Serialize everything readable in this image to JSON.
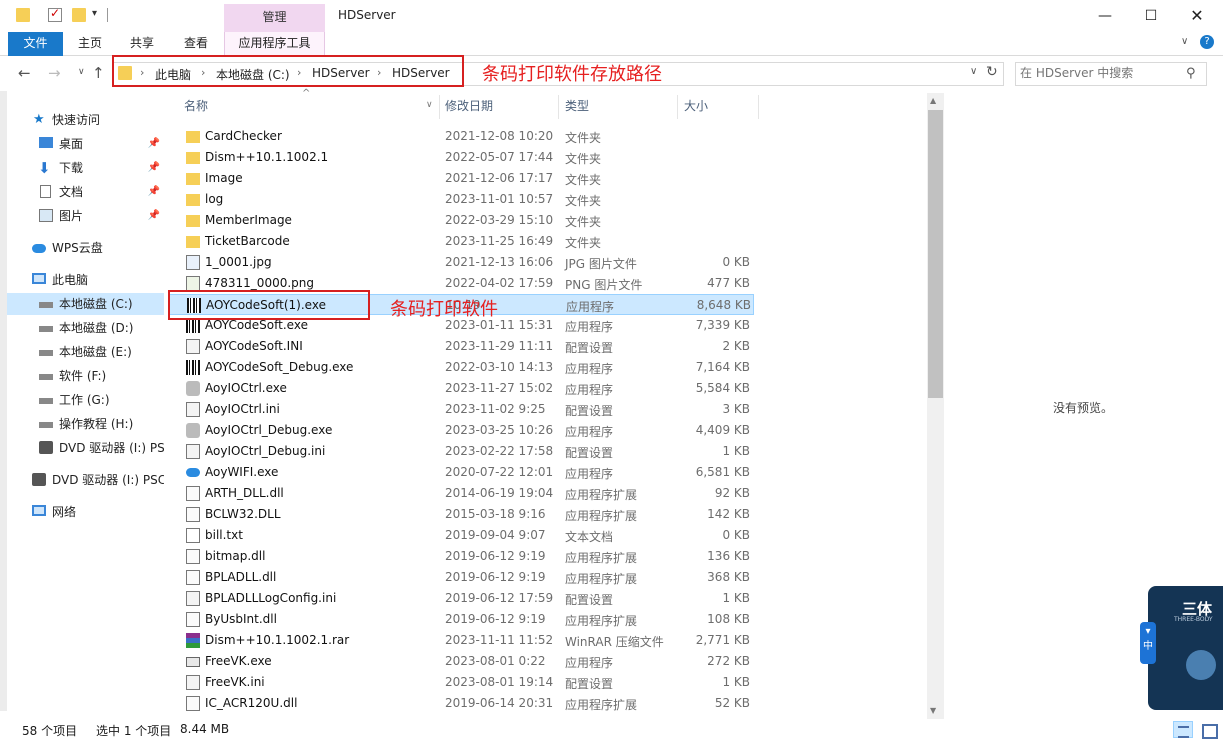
{
  "window": {
    "title": "HDServer",
    "manage_label": "管理"
  },
  "ribbon": {
    "file": "文件",
    "home": "主页",
    "share": "共享",
    "view": "查看",
    "app_tools": "应用程序工具"
  },
  "address": {
    "crumbs": [
      "此电脑",
      "本地磁盘 (C:)",
      "HDServer",
      "HDServer"
    ],
    "search_placeholder": "在 HDServer 中搜索"
  },
  "annotations": {
    "address": "条码打印软件存放路径",
    "row": "条码打印软件"
  },
  "nav": {
    "quick_access": "快速访问",
    "desktop": "桌面",
    "downloads": "下载",
    "documents": "文档",
    "pictures": "图片",
    "wps": "WPS云盘",
    "this_pc": "此电脑",
    "drive_c": "本地磁盘 (C:)",
    "drive_d": "本地磁盘 (D:)",
    "drive_e": "本地磁盘 (E:)",
    "drive_f": "软件 (F:)",
    "drive_g": "工作 (G:)",
    "drive_h": "操作教程 (H:)",
    "dvd_i": "DVD 驱动器 (I:) PS",
    "dvd_i2": "DVD 驱动器 (I:) PSC",
    "network": "网络"
  },
  "columns": {
    "name": "名称",
    "date": "修改日期",
    "type": "类型",
    "size": "大小"
  },
  "files": [
    {
      "name": "CardChecker",
      "date": "2021-12-08 10:20",
      "type": "文件夹",
      "size": "",
      "icon": "folder-icon"
    },
    {
      "name": "Dism++10.1.1002.1",
      "date": "2022-05-07 17:44",
      "type": "文件夹",
      "size": "",
      "icon": "folder-icon"
    },
    {
      "name": "Image",
      "date": "2021-12-06 17:17",
      "type": "文件夹",
      "size": "",
      "icon": "folder-icon"
    },
    {
      "name": "log",
      "date": "2023-11-01 10:57",
      "type": "文件夹",
      "size": "",
      "icon": "folder-icon"
    },
    {
      "name": "MemberImage",
      "date": "2022-03-29 15:10",
      "type": "文件夹",
      "size": "",
      "icon": "folder-icon"
    },
    {
      "name": "TicketBarcode",
      "date": "2023-11-25 16:49",
      "type": "文件夹",
      "size": "",
      "icon": "folder-icon"
    },
    {
      "name": "1_0001.jpg",
      "date": "2021-12-13 16:06",
      "type": "JPG 图片文件",
      "size": "0 KB",
      "icon": "jpg-icon"
    },
    {
      "name": "478311_0000.png",
      "date": "2022-04-02 17:59",
      "type": "PNG 图片文件",
      "size": "477 KB",
      "icon": "png-icon"
    },
    {
      "name": "AOYCodeSoft(1).exe",
      "date": "10:19",
      "type": "应用程序",
      "size": "8,648 KB",
      "icon": "barcode-icon",
      "selected": true
    },
    {
      "name": "AOYCodeSoft.exe",
      "date": "2023-01-11 15:31",
      "type": "应用程序",
      "size": "7,339 KB",
      "icon": "barcode-icon"
    },
    {
      "name": "AOYCodeSoft.INI",
      "date": "2023-11-29 11:11",
      "type": "配置设置",
      "size": "2 KB",
      "icon": "config-icon"
    },
    {
      "name": "AOYCodeSoft_Debug.exe",
      "date": "2022-03-10 14:13",
      "type": "应用程序",
      "size": "7,164 KB",
      "icon": "barcode-icon"
    },
    {
      "name": "AoyIOCtrl.exe",
      "date": "2023-11-27 15:02",
      "type": "应用程序",
      "size": "5,584 KB",
      "icon": "app-icon"
    },
    {
      "name": "AoyIOCtrl.ini",
      "date": "2023-11-02 9:25",
      "type": "配置设置",
      "size": "3 KB",
      "icon": "config-icon"
    },
    {
      "name": "AoyIOCtrl_Debug.exe",
      "date": "2023-03-25 10:26",
      "type": "应用程序",
      "size": "4,409 KB",
      "icon": "app-icon"
    },
    {
      "name": "AoyIOCtrl_Debug.ini",
      "date": "2023-02-22 17:58",
      "type": "配置设置",
      "size": "1 KB",
      "icon": "config-icon"
    },
    {
      "name": "AoyWIFI.exe",
      "date": "2020-07-22 12:01",
      "type": "应用程序",
      "size": "6,581 KB",
      "icon": "cloud-icon"
    },
    {
      "name": "ARTH_DLL.dll",
      "date": "2014-06-19 19:04",
      "type": "应用程序扩展",
      "size": "92 KB",
      "icon": "dll-icon"
    },
    {
      "name": "BCLW32.DLL",
      "date": "2015-03-18 9:16",
      "type": "应用程序扩展",
      "size": "142 KB",
      "icon": "dll-icon"
    },
    {
      "name": "bill.txt",
      "date": "2019-09-04 9:07",
      "type": "文本文档",
      "size": "0 KB",
      "icon": "text-icon"
    },
    {
      "name": "bitmap.dll",
      "date": "2019-06-12 9:19",
      "type": "应用程序扩展",
      "size": "136 KB",
      "icon": "dll-icon"
    },
    {
      "name": "BPLADLL.dll",
      "date": "2019-06-12 9:19",
      "type": "应用程序扩展",
      "size": "368 KB",
      "icon": "dll-icon"
    },
    {
      "name": "BPLADLLLogConfig.ini",
      "date": "2019-06-12 17:59",
      "type": "配置设置",
      "size": "1 KB",
      "icon": "config-icon"
    },
    {
      "name": "ByUsbInt.dll",
      "date": "2019-06-12 9:19",
      "type": "应用程序扩展",
      "size": "108 KB",
      "icon": "dll-icon"
    },
    {
      "name": "Dism++10.1.1002.1.rar",
      "date": "2023-11-11 11:52",
      "type": "WinRAR 压缩文件",
      "size": "2,771 KB",
      "icon": "rar-icon"
    },
    {
      "name": "FreeVK.exe",
      "date": "2023-08-01 0:22",
      "type": "应用程序",
      "size": "272 KB",
      "icon": "keyboard-icon"
    },
    {
      "name": "FreeVK.ini",
      "date": "2023-08-01 19:14",
      "type": "配置设置",
      "size": "1 KB",
      "icon": "config-icon"
    },
    {
      "name": "IC_ACR120U.dll",
      "date": "2019-06-14 20:31",
      "type": "应用程序扩展",
      "size": "52 KB",
      "icon": "dll-icon"
    }
  ],
  "preview": {
    "empty_text": "没有预览。"
  },
  "widget": {
    "title": "三体",
    "subtitle": "THREE-BODY",
    "tab_label": "中"
  },
  "status": {
    "count": "58 个项目",
    "selected": "选中 1 个项目",
    "size": "8.44 MB"
  },
  "colors": {
    "accent": "#1979ca",
    "selection": "#cce8ff",
    "annotation": "#e62020",
    "folder": "#f6cf57"
  }
}
